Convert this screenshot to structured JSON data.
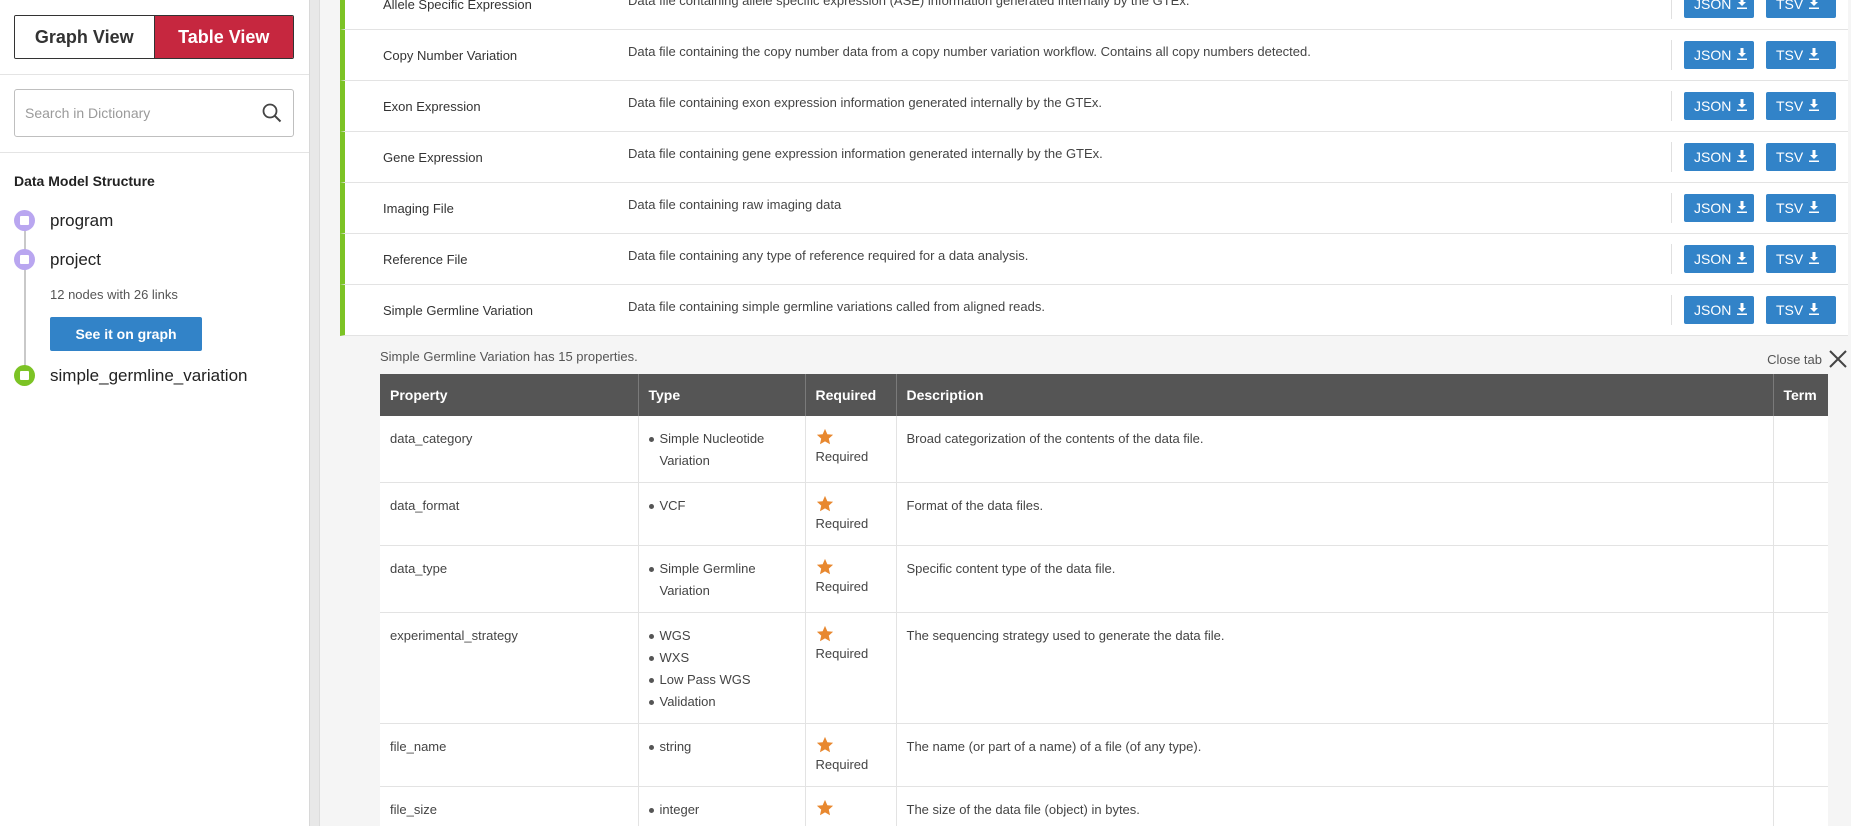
{
  "sidebar": {
    "view_toggle": {
      "graph": "Graph View",
      "table": "Table View"
    },
    "search": {
      "placeholder": "Search in Dictionary"
    },
    "structure_title": "Data Model Structure",
    "nodes": [
      {
        "label": "program",
        "color": "#b9a6f0"
      },
      {
        "label": "project",
        "color": "#b9a6f0"
      },
      {
        "label": "simple_germline_variation",
        "color": "#7cc325"
      }
    ],
    "meta": "12 nodes with 26 links",
    "see_graph": "See it on graph"
  },
  "node_rows": [
    {
      "name": "Allele Specific Expression",
      "desc": "Data file containing allele specific expression (ASE) information generated internally by the GTEx."
    },
    {
      "name": "Copy Number Variation",
      "desc": "Data file containing the copy number data from a copy number variation workflow. Contains all copy numbers detected."
    },
    {
      "name": "Exon Expression",
      "desc": "Data file containing exon expression information generated internally by the GTEx."
    },
    {
      "name": "Gene Expression",
      "desc": "Data file containing gene expression information generated internally by the GTEx."
    },
    {
      "name": "Imaging File",
      "desc": "Data file containing raw imaging data"
    },
    {
      "name": "Reference File",
      "desc": "Data file containing any type of reference required for a data analysis."
    },
    {
      "name": "Simple Germline Variation",
      "desc": "Data file containing simple germline variations called from aligned reads."
    }
  ],
  "buttons": {
    "json": "JSON",
    "tsv": "TSV"
  },
  "tab": {
    "summary": "Simple Germline Variation has 15 properties.",
    "close": "Close tab",
    "headers": {
      "property": "Property",
      "type": "Type",
      "required": "Required",
      "description": "Description",
      "term": "Term"
    },
    "rows": [
      {
        "property": "data_category",
        "types": [
          "Simple Nucleotide Variation"
        ],
        "required": "Required",
        "description": "Broad categorization of the contents of the data file."
      },
      {
        "property": "data_format",
        "types": [
          "VCF"
        ],
        "required": "Required",
        "description": "Format of the data files."
      },
      {
        "property": "data_type",
        "types": [
          "Simple Germline Variation"
        ],
        "required": "Required",
        "description": "Specific content type of the data file."
      },
      {
        "property": "experimental_strategy",
        "types": [
          "WGS",
          "WXS",
          "Low Pass WGS",
          "Validation"
        ],
        "required": "Required",
        "description": "The sequencing strategy used to generate the data file."
      },
      {
        "property": "file_name",
        "types": [
          "string"
        ],
        "required": "Required",
        "description": "The name (or part of a name) of a file (of any type)."
      },
      {
        "property": "file_size",
        "types": [
          "integer"
        ],
        "required": "",
        "description": "The size of the data file (object) in bytes."
      }
    ]
  },
  "colors": {
    "accent": "#3283c8",
    "brand_red": "#c6273f",
    "node_green": "#7cc325",
    "required_orange": "#e8882f"
  }
}
